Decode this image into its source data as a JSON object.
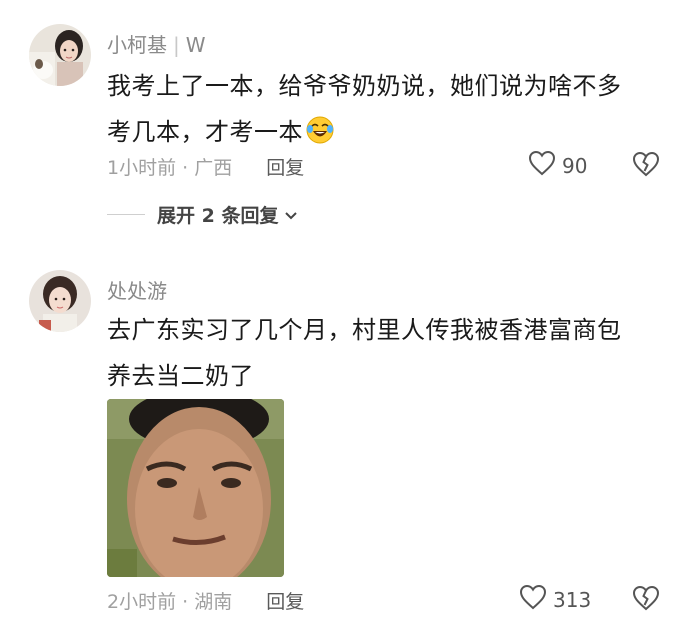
{
  "comments": [
    {
      "username": "小柯基",
      "sep": "|",
      "tag": "W",
      "text_line1": "我考上了一本，给爷爷奶奶说，她们说为啥不多",
      "text_line2": "考几本，才考一本",
      "emoji": "laughing-crying-emoji",
      "time": "1小时前",
      "dot": "·",
      "location": "广西",
      "reply_label": "回复",
      "likes": "90",
      "expand_label": "展开 2 条回复"
    },
    {
      "username": "处处游",
      "text_line1": "去广东实习了几个月，村里人传我被香港富商包",
      "text_line2": "养去当二奶了",
      "time": "2小时前",
      "dot": "·",
      "location": "湖南",
      "reply_label": "回复",
      "likes": "313"
    }
  ],
  "icons": {
    "like": "heart-outline-icon",
    "dislike": "broken-heart-icon",
    "expand": "chevron-down-icon"
  }
}
